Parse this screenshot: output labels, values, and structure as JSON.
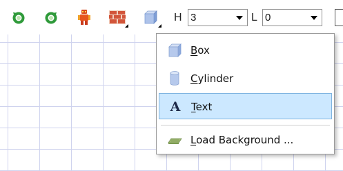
{
  "toolbar": {
    "buttons": [
      {
        "name": "rotate-left-button",
        "icon": "rotate-left-icon"
      },
      {
        "name": "rotate-right-button",
        "icon": "rotate-right-icon"
      },
      {
        "name": "robot-button",
        "icon": "robot-icon"
      },
      {
        "name": "brick-wall-button",
        "icon": "brick-wall-icon"
      },
      {
        "name": "shape-button",
        "icon": "cube-icon"
      }
    ],
    "h_label": "H",
    "h_value": "3",
    "l_label": "L",
    "l_value": "0"
  },
  "menu": {
    "items": [
      {
        "label": "Box",
        "mnemonic": "B",
        "icon": "box-icon"
      },
      {
        "label": "Cylinder",
        "mnemonic": "C",
        "icon": "cylinder-icon"
      },
      {
        "label": "Text",
        "mnemonic": "T",
        "icon": "text-a-icon",
        "selected": true
      },
      {
        "label": "Load Background ...",
        "mnemonic": "L",
        "icon": "background-image-icon"
      }
    ]
  },
  "colors": {
    "grid": "#cfd3ee",
    "selection": "#cce8ff",
    "selection_border": "#7fb4e0"
  }
}
